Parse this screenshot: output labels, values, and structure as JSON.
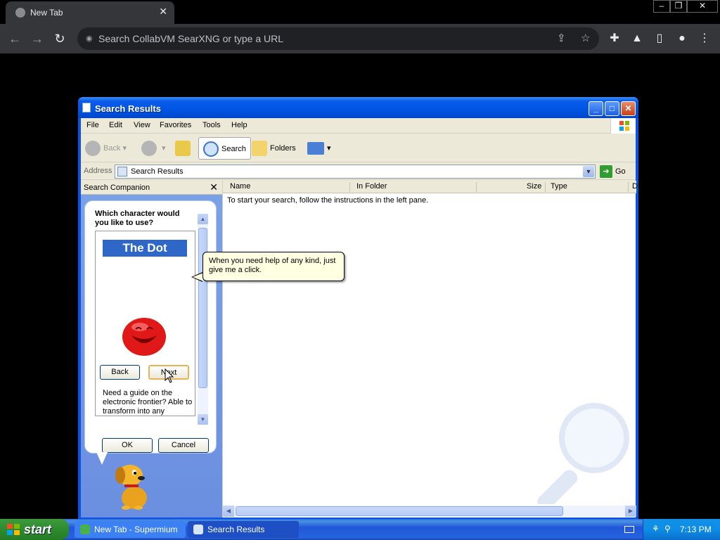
{
  "browser": {
    "tab_title": "New Tab",
    "address_placeholder": "Search CollabVM SearXNG or type a URL",
    "icons": [
      "back-icon",
      "forward-icon",
      "reload-icon",
      "share-icon",
      "star-icon",
      "extensions-icon",
      "labs-icon",
      "sidebar-icon",
      "profile-icon",
      "menu-icon"
    ]
  },
  "window": {
    "title": "Search Results",
    "menu": [
      "File",
      "Edit",
      "View",
      "Favorites",
      "Tools",
      "Help"
    ],
    "toolbar": {
      "back": "Back",
      "search": "Search",
      "folders": "Folders"
    },
    "address_label": "Address",
    "address_value": "Search Results",
    "go_label": "Go"
  },
  "companion": {
    "header": "Search Companion",
    "question": "Which character would you like to use?",
    "character_name": "The Dot",
    "back_label": "Back",
    "next_label": "Next",
    "description": "Need a guide on the electronic frontier? Able to transform into any",
    "ok_label": "OK",
    "cancel_label": "Cancel"
  },
  "results": {
    "columns": [
      "Name",
      "In Folder",
      "Size",
      "Type",
      "D"
    ],
    "empty_message": "To start your search, follow the instructions in the left pane.",
    "tooltip": "When you need help of any kind, just give me a click."
  },
  "taskbar": {
    "start_label": "start",
    "items": [
      "New Tab - Supermium",
      "Search Results"
    ],
    "clock": "7:13 PM"
  },
  "colors": {
    "xp_blue": "#0a53e6",
    "pane_blue": "#7ba2e7",
    "start_green": "#2e8b2e"
  }
}
